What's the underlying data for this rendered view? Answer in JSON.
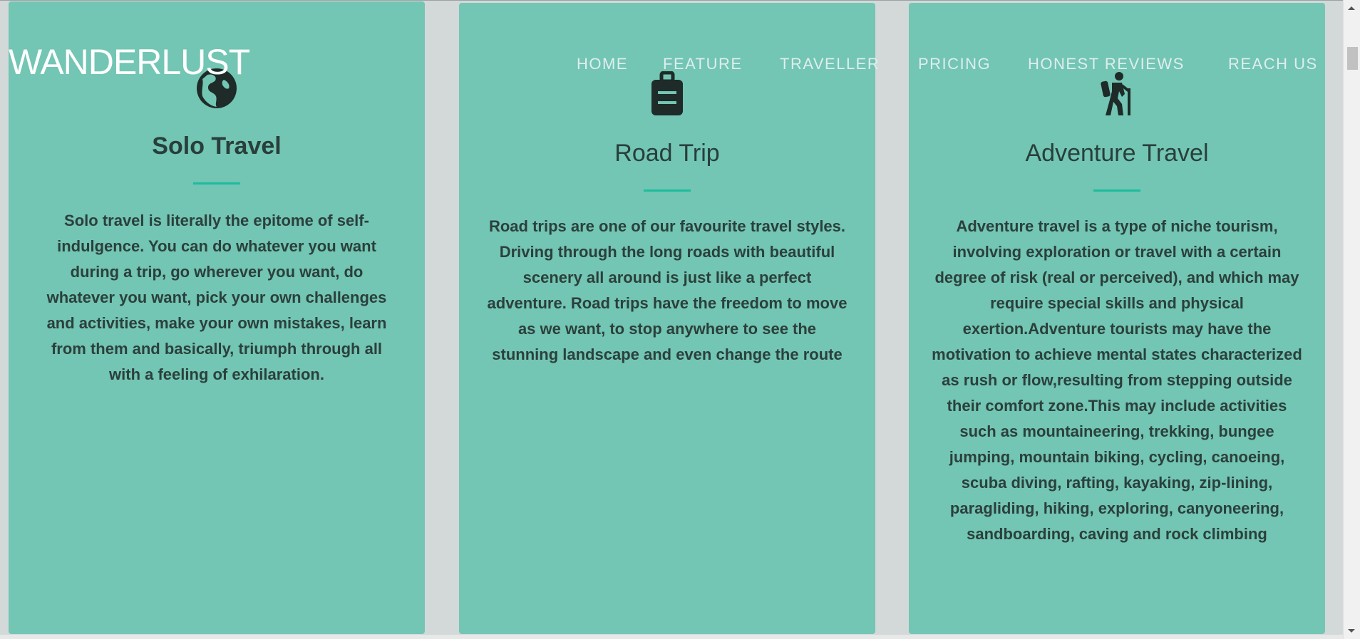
{
  "brand": "WANDERLUST",
  "nav": [
    "HOME",
    "FEATURE",
    "TRAVELLER",
    "PRICING",
    "HONEST REVIEWS",
    "REACH US"
  ],
  "cards": [
    {
      "icon": "globe-africa-icon",
      "title": "Solo Travel",
      "text": "Solo travel is literally the epitome of self-indulgence. You can do whatever you want during a trip, go wherever you want, do whatever you want, pick your own challenges and activities, make your own mistakes, learn from them and basically, triumph through all with a feeling of exhilaration."
    },
    {
      "icon": "suitcase-rolling-icon",
      "title": "Road Trip",
      "text": "Road trips are one of our favourite travel styles. Driving through the long roads with beautiful scenery all around is just like a perfect adventure. Road trips have the freedom to move as we want, to stop anywhere to see the stunning landscape and even change the route"
    },
    {
      "icon": "hiking-icon",
      "title": "Adventure Travel",
      "text": "Adventure travel is a type of niche tourism, involving exploration or travel with a certain degree of risk (real or perceived), and which may require special skills and physical exertion.Adventure tourists may have the motivation to achieve mental states characterized as rush or flow,resulting from stepping outside their comfort zone.This may include activities such as mountaineering, trekking, bungee jumping, mountain biking, cycling, canoeing, scuba diving, rafting, kayaking, zip-lining, paragliding, hiking, exploring, canyoneering, sandboarding, caving and rock climbing"
    }
  ],
  "colors": {
    "card": "#73c5b4",
    "accent": "#1dbc9c",
    "page": "#d3d8d9",
    "text": "#283f3b"
  }
}
